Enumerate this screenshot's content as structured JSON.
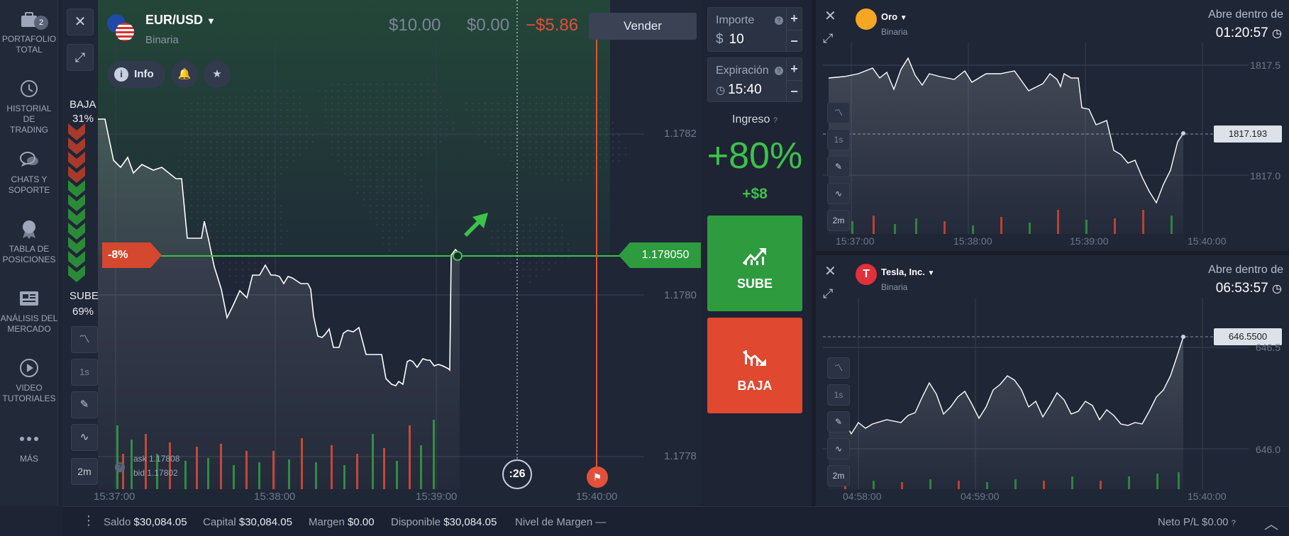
{
  "nav": {
    "items": [
      {
        "label1": "PORTAFOLIO",
        "label2": "TOTAL",
        "badge": "2",
        "icon": "briefcase-icon"
      },
      {
        "label1": "HISTORIAL DE",
        "label2": "TRADING",
        "icon": "history-icon"
      },
      {
        "label1": "CHATS Y",
        "label2": "SOPORTE",
        "icon": "chat-icon"
      },
      {
        "label1": "TABLA DE",
        "label2": "POSICIONES",
        "icon": "medal-icon"
      },
      {
        "label1": "ANÁLISIS DEL",
        "label2": "MERCADO",
        "icon": "newspaper-icon"
      },
      {
        "label1": "VIDEO",
        "label2": "TUTORIALES",
        "icon": "play-icon"
      },
      {
        "label1": "MÁS",
        "label2": "",
        "icon": "more-icon"
      }
    ]
  },
  "main": {
    "asset": "EUR/USD",
    "asset_type": "Binaria",
    "info_label": "Info",
    "investment": "$10.00",
    "pnl_zero": "$0.00",
    "pnl": "−$5.86",
    "sell_label": "Vender",
    "baja_label": "BAJA",
    "baja_pct": "31%",
    "sube_label": "SUBE",
    "sube_pct": "69%",
    "deal_pct": "-8%",
    "current_price": "1.178050",
    "y_ticks": [
      "1.1782",
      "1.1780",
      "1.1778"
    ],
    "x_ticks": [
      "15:37:00",
      "15:38:00",
      "15:39:00",
      "15:40:00"
    ],
    "ask": "ask 1.17808",
    "bid": "bid 1.17802",
    "countdown": ":26",
    "timeframe": "1s",
    "period": "2m",
    "colors": {
      "up": "#2f9b3f",
      "down": "#e0482f"
    }
  },
  "panel": {
    "amount_label": "Importe",
    "amount_currency": "$",
    "amount_value": "10",
    "expiry_label": "Expiración",
    "expiry_value": "15:40",
    "income_label": "Ingreso",
    "income_pct": "+80%",
    "income_amount": "+$8",
    "up_button": "SUBE",
    "down_button": "BAJA"
  },
  "mini1": {
    "name": "Oro",
    "type": "Binaria",
    "opens_label": "Abre dentro de",
    "opens_time": "01:20:57",
    "price": "1817.193",
    "y_ticks": [
      "1817.5",
      "1817.0"
    ],
    "x_ticks": [
      "15:37:00",
      "15:38:00",
      "15:39:00",
      "15:40:00"
    ],
    "timeframe": "1s",
    "period": "2m"
  },
  "mini2": {
    "name": "Tesla, Inc.",
    "type": "Binaria",
    "opens_label": "Abre dentro de",
    "opens_time": "06:53:57",
    "price": "646.5500",
    "y_ticks": [
      "646.5",
      "646.0"
    ],
    "x_ticks": [
      "04:58:00",
      "04:59:00",
      "15:40:00"
    ],
    "timeframe": "1s",
    "period": "2m"
  },
  "bottom": {
    "saldo_label": "Saldo",
    "saldo": "$30,084.05",
    "capital_label": "Capital",
    "capital": "$30,084.05",
    "margen_label": "Margen",
    "margen": "$0.00",
    "disponible_label": "Disponible",
    "disponible": "$30,084.05",
    "nivel_label": "Nivel de Margen",
    "nivel": "—",
    "neto_label": "Neto P/L",
    "neto": "$0.00"
  }
}
